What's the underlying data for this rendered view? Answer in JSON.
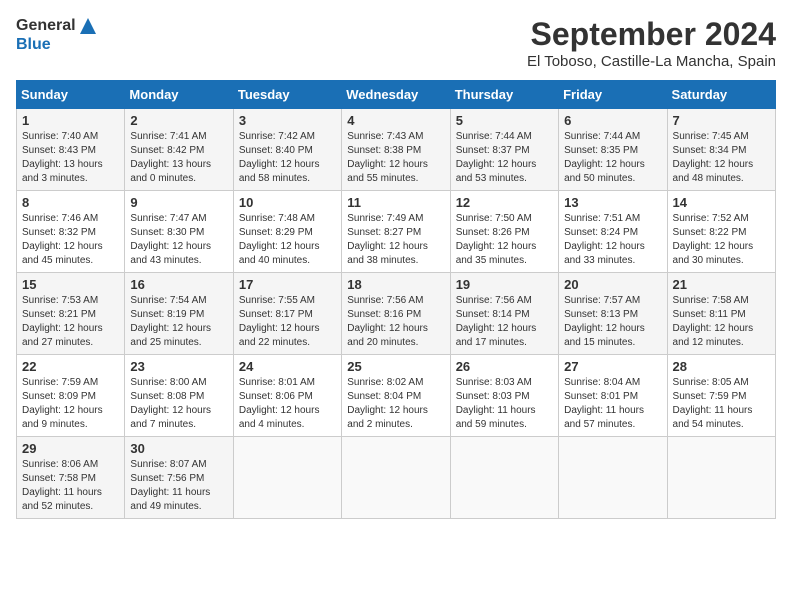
{
  "header": {
    "logo_general": "General",
    "logo_blue": "Blue",
    "month_title": "September 2024",
    "location": "El Toboso, Castille-La Mancha, Spain"
  },
  "days_of_week": [
    "Sunday",
    "Monday",
    "Tuesday",
    "Wednesday",
    "Thursday",
    "Friday",
    "Saturday"
  ],
  "weeks": [
    [
      {
        "day": "1",
        "sunrise": "7:40 AM",
        "sunset": "8:43 PM",
        "daylight": "13 hours and 3 minutes."
      },
      {
        "day": "2",
        "sunrise": "7:41 AM",
        "sunset": "8:42 PM",
        "daylight": "13 hours and 0 minutes."
      },
      {
        "day": "3",
        "sunrise": "7:42 AM",
        "sunset": "8:40 PM",
        "daylight": "12 hours and 58 minutes."
      },
      {
        "day": "4",
        "sunrise": "7:43 AM",
        "sunset": "8:38 PM",
        "daylight": "12 hours and 55 minutes."
      },
      {
        "day": "5",
        "sunrise": "7:44 AM",
        "sunset": "8:37 PM",
        "daylight": "12 hours and 53 minutes."
      },
      {
        "day": "6",
        "sunrise": "7:44 AM",
        "sunset": "8:35 PM",
        "daylight": "12 hours and 50 minutes."
      },
      {
        "day": "7",
        "sunrise": "7:45 AM",
        "sunset": "8:34 PM",
        "daylight": "12 hours and 48 minutes."
      }
    ],
    [
      {
        "day": "8",
        "sunrise": "7:46 AM",
        "sunset": "8:32 PM",
        "daylight": "12 hours and 45 minutes."
      },
      {
        "day": "9",
        "sunrise": "7:47 AM",
        "sunset": "8:30 PM",
        "daylight": "12 hours and 43 minutes."
      },
      {
        "day": "10",
        "sunrise": "7:48 AM",
        "sunset": "8:29 PM",
        "daylight": "12 hours and 40 minutes."
      },
      {
        "day": "11",
        "sunrise": "7:49 AM",
        "sunset": "8:27 PM",
        "daylight": "12 hours and 38 minutes."
      },
      {
        "day": "12",
        "sunrise": "7:50 AM",
        "sunset": "8:26 PM",
        "daylight": "12 hours and 35 minutes."
      },
      {
        "day": "13",
        "sunrise": "7:51 AM",
        "sunset": "8:24 PM",
        "daylight": "12 hours and 33 minutes."
      },
      {
        "day": "14",
        "sunrise": "7:52 AM",
        "sunset": "8:22 PM",
        "daylight": "12 hours and 30 minutes."
      }
    ],
    [
      {
        "day": "15",
        "sunrise": "7:53 AM",
        "sunset": "8:21 PM",
        "daylight": "12 hours and 27 minutes."
      },
      {
        "day": "16",
        "sunrise": "7:54 AM",
        "sunset": "8:19 PM",
        "daylight": "12 hours and 25 minutes."
      },
      {
        "day": "17",
        "sunrise": "7:55 AM",
        "sunset": "8:17 PM",
        "daylight": "12 hours and 22 minutes."
      },
      {
        "day": "18",
        "sunrise": "7:56 AM",
        "sunset": "8:16 PM",
        "daylight": "12 hours and 20 minutes."
      },
      {
        "day": "19",
        "sunrise": "7:56 AM",
        "sunset": "8:14 PM",
        "daylight": "12 hours and 17 minutes."
      },
      {
        "day": "20",
        "sunrise": "7:57 AM",
        "sunset": "8:13 PM",
        "daylight": "12 hours and 15 minutes."
      },
      {
        "day": "21",
        "sunrise": "7:58 AM",
        "sunset": "8:11 PM",
        "daylight": "12 hours and 12 minutes."
      }
    ],
    [
      {
        "day": "22",
        "sunrise": "7:59 AM",
        "sunset": "8:09 PM",
        "daylight": "12 hours and 9 minutes."
      },
      {
        "day": "23",
        "sunrise": "8:00 AM",
        "sunset": "8:08 PM",
        "daylight": "12 hours and 7 minutes."
      },
      {
        "day": "24",
        "sunrise": "8:01 AM",
        "sunset": "8:06 PM",
        "daylight": "12 hours and 4 minutes."
      },
      {
        "day": "25",
        "sunrise": "8:02 AM",
        "sunset": "8:04 PM",
        "daylight": "12 hours and 2 minutes."
      },
      {
        "day": "26",
        "sunrise": "8:03 AM",
        "sunset": "8:03 PM",
        "daylight": "11 hours and 59 minutes."
      },
      {
        "day": "27",
        "sunrise": "8:04 AM",
        "sunset": "8:01 PM",
        "daylight": "11 hours and 57 minutes."
      },
      {
        "day": "28",
        "sunrise": "8:05 AM",
        "sunset": "7:59 PM",
        "daylight": "11 hours and 54 minutes."
      }
    ],
    [
      {
        "day": "29",
        "sunrise": "8:06 AM",
        "sunset": "7:58 PM",
        "daylight": "11 hours and 52 minutes."
      },
      {
        "day": "30",
        "sunrise": "8:07 AM",
        "sunset": "7:56 PM",
        "daylight": "11 hours and 49 minutes."
      },
      null,
      null,
      null,
      null,
      null
    ]
  ],
  "labels": {
    "sunrise": "Sunrise:",
    "sunset": "Sunset:",
    "daylight": "Daylight:"
  }
}
